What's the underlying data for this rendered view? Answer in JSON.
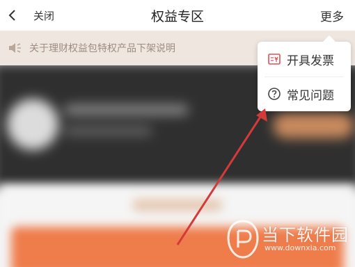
{
  "nav": {
    "close_label": "关闭",
    "title": "权益专区",
    "more_label": "更多",
    "back_icon": "chevron-left-icon"
  },
  "notice": {
    "icon": "speaker-icon",
    "text": "关于理财权益包特权产品下架说明"
  },
  "menu": {
    "items": [
      {
        "icon": "invoice-icon",
        "label": "开具发票"
      },
      {
        "icon": "question-icon",
        "label": "常见问题"
      }
    ]
  },
  "watermark": {
    "title": "当下软件园",
    "url": "www.downxia.com"
  },
  "colors": {
    "accent": "#e04e5a",
    "notice_bg": "#efe6e0",
    "notice_text": "#9e8c82",
    "annotation_arrow": "#d33a3a"
  }
}
